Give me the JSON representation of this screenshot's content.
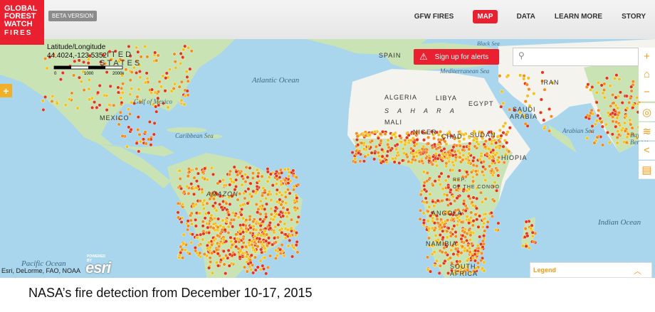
{
  "logo": {
    "line1": "GLOBAL",
    "line2": "FOREST",
    "line3": "WATCH",
    "line4": "FIRES"
  },
  "beta_label": "BETA VERSION",
  "nav": {
    "items": [
      "GFW FIRES",
      "MAP",
      "DATA",
      "LEARN MORE",
      "STORY"
    ],
    "active": "MAP"
  },
  "map": {
    "latlon_title": "Latitude/Longitude",
    "latlon_value": "44.4024,-123.5352",
    "scale_labels": [
      "0",
      "1000",
      "2000km"
    ],
    "alert_button": "Sign up for alerts",
    "search_placeholder": "",
    "attribution": "Esri, DeLorme, FAO, NOAA",
    "esri_logo": "esri",
    "esri_powered": "POWERED BY",
    "legend_title": "Legend",
    "oceans": [
      "Atlantic Ocean",
      "Indian Ocean",
      "Pacific Ocean",
      "Arabian Sea",
      "Caribbean Sea",
      "Gulf of Mexico",
      "Black Sea",
      "Mediterranean Sea"
    ],
    "labels": {
      "algeria": "ALGERIA",
      "libya": "LIBYA",
      "egypt": "EGYPT",
      "mali": "MALI",
      "niger": "NIGER",
      "chad": "CHAD",
      "sudan": "SUDAN",
      "saudi": "SAUDI",
      "arabia": "ARABIA",
      "iran": "IRAN",
      "spain": "SPAIN",
      "sahara": "S A H A R A",
      "angola": "ANGOLA",
      "namibia": "NAMIBIA",
      "south": "SOUTH",
      "africa": "AFRICA",
      "congo": "OF THE CONGO",
      "rep": "REP.",
      "ethiopia": "HIOPIA",
      "amazon": "AMAZON",
      "united": "ITED",
      "states": "STATES",
      "mexico": "MEXICO",
      "bay": "Bay of",
      "bengal": "Bengal"
    }
  },
  "side_icons": [
    "plus-icon",
    "home-icon",
    "minus-icon",
    "locate-icon",
    "layers-icon",
    "share-icon",
    "print-icon"
  ],
  "caption": "NASA’s fire detection from December 10-17, 2015",
  "colors": {
    "brand": "#e8202f",
    "accent": "#f29b13",
    "water": "#a9d6ec",
    "land": "#c9e3b5",
    "desert": "#f5f3ee",
    "fire_red": "#e2361b",
    "fire_orange": "#f28d1b",
    "fire_yellow": "#f3c21a"
  }
}
